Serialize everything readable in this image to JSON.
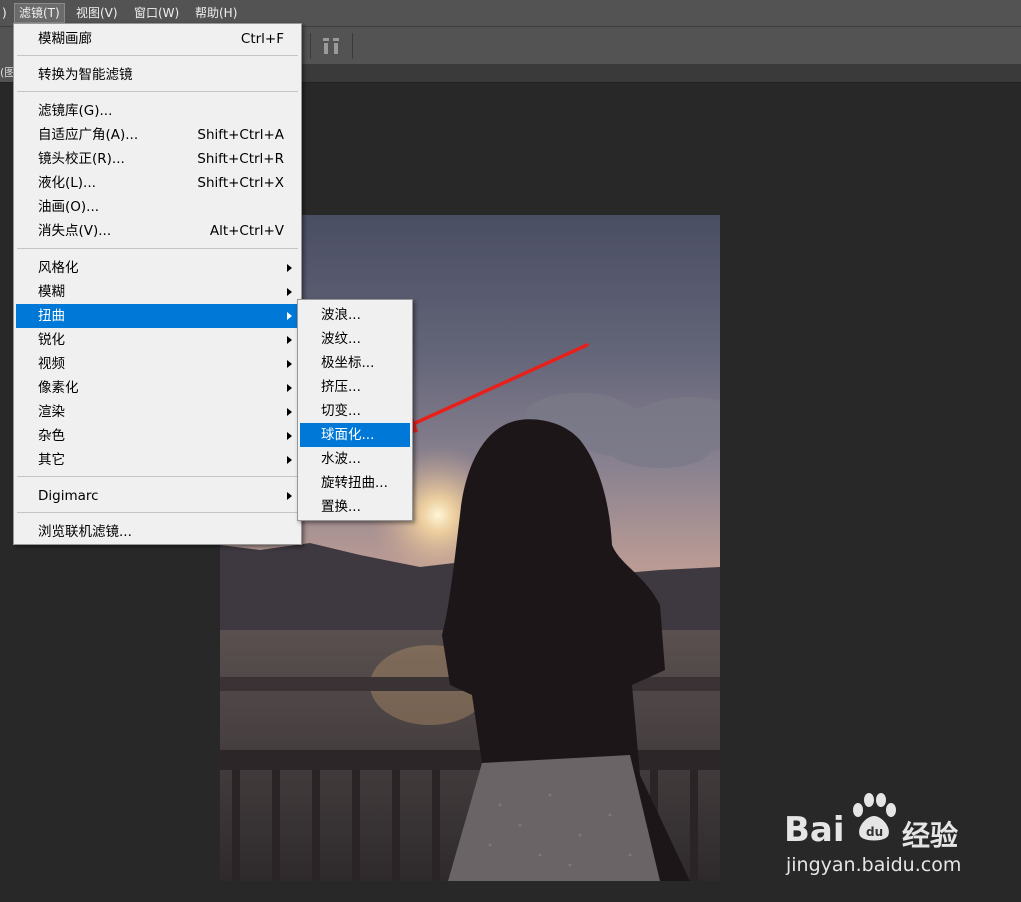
{
  "menubar": {
    "items": [
      {
        "label": ")"
      },
      {
        "label": "滤镜(T)"
      },
      {
        "label": "视图(V)"
      },
      {
        "label": "窗口(W)"
      },
      {
        "label": "帮助(H)"
      }
    ]
  },
  "doc_tab": {
    "label": "(图"
  },
  "filter_menu": {
    "last_filter": {
      "label": "模糊画廊",
      "shortcut": "Ctrl+F"
    },
    "smart": {
      "label": "转换为智能滤镜"
    },
    "tools": [
      {
        "label": "滤镜库(G)...",
        "shortcut": ""
      },
      {
        "label": "自适应广角(A)...",
        "shortcut": "Shift+Ctrl+A"
      },
      {
        "label": "镜头校正(R)...",
        "shortcut": "Shift+Ctrl+R"
      },
      {
        "label": "液化(L)...",
        "shortcut": "Shift+Ctrl+X"
      },
      {
        "label": "油画(O)...",
        "shortcut": ""
      },
      {
        "label": "消失点(V)...",
        "shortcut": "Alt+Ctrl+V"
      }
    ],
    "groups": [
      {
        "label": "风格化"
      },
      {
        "label": "模糊"
      },
      {
        "label": "扭曲"
      },
      {
        "label": "锐化"
      },
      {
        "label": "视频"
      },
      {
        "label": "像素化"
      },
      {
        "label": "渲染"
      },
      {
        "label": "杂色"
      },
      {
        "label": "其它"
      }
    ],
    "digimarc": {
      "label": "Digimarc"
    },
    "browse": {
      "label": "浏览联机滤镜..."
    }
  },
  "distort_submenu": {
    "items": [
      {
        "label": "波浪..."
      },
      {
        "label": "波纹..."
      },
      {
        "label": "极坐标..."
      },
      {
        "label": "挤压..."
      },
      {
        "label": "切变..."
      },
      {
        "label": "球面化..."
      },
      {
        "label": "水波..."
      },
      {
        "label": "旋转扭曲..."
      },
      {
        "label": "置换..."
      }
    ],
    "highlighted_index": 5
  },
  "watermark": {
    "brand": "Bai",
    "brand_cn": "经验",
    "url": "jingyan.baidu.com"
  },
  "colors": {
    "highlight": "#0078d7",
    "arrow": "#e8201c",
    "panel": "#535353"
  }
}
